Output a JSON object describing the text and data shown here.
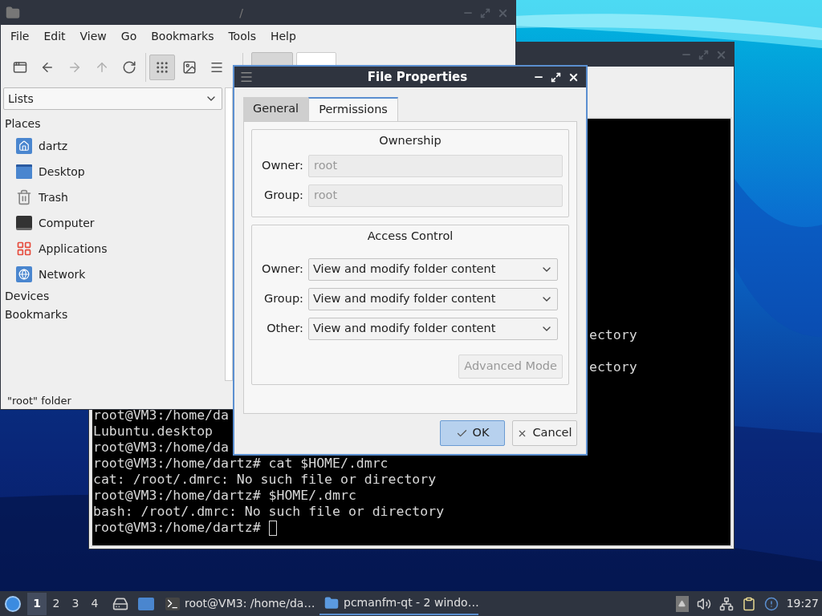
{
  "file_manager": {
    "title": "/",
    "menu": [
      "File",
      "Edit",
      "View",
      "Go",
      "Bookmarks",
      "Tools",
      "Help"
    ],
    "nav": [
      {
        "kind": "new-window",
        "disabled": false
      },
      {
        "kind": "back",
        "disabled": false
      },
      {
        "kind": "forward",
        "disabled": true
      },
      {
        "kind": "up",
        "disabled": true
      },
      {
        "kind": "reload",
        "disabled": false
      }
    ],
    "views": [
      {
        "kind": "icons",
        "selected": true
      },
      {
        "kind": "thumbnails",
        "selected": false
      },
      {
        "kind": "list",
        "selected": false
      }
    ],
    "side_pane": {
      "mode": "Lists",
      "sections": [
        {
          "title": "Places",
          "items": [
            {
              "label": "dartz",
              "kind": "home"
            },
            {
              "label": "Desktop",
              "kind": "desktop"
            },
            {
              "label": "Trash",
              "kind": "trash"
            },
            {
              "label": "Computer",
              "kind": "computer"
            },
            {
              "label": "Applications",
              "kind": "applications"
            },
            {
              "label": "Network",
              "kind": "network"
            }
          ]
        },
        {
          "title": "Devices"
        },
        {
          "title": "Bookmarks"
        }
      ]
    },
    "status": "\"root\" folder"
  },
  "terminal": {
    "tails": [
      "ectory",
      "ectory"
    ],
    "lines": [
      "root@VM3:/home/da",
      "Lubuntu.desktop",
      "root@VM3:/home/da",
      "root@VM3:/home/dartz# cat $HOME/.dmrc",
      "cat: /root/.dmrc: No such file or directory",
      "root@VM3:/home/dartz# $HOME/.dmrc",
      "bash: /root/.dmrc: No such file or directory",
      "root@VM3:/home/dartz# "
    ]
  },
  "dialog": {
    "title": "File Properties",
    "tabs": [
      {
        "label": "General",
        "selected": false
      },
      {
        "label": "Permissions",
        "selected": true
      }
    ],
    "ownership": {
      "title": "Ownership",
      "fields": [
        {
          "label": "Owner:",
          "value": "root",
          "disabled": true
        },
        {
          "label": "Group:",
          "value": "root",
          "disabled": true
        }
      ]
    },
    "access": {
      "title": "Access Control",
      "rows": [
        {
          "label": "Owner:",
          "value": "View and modify folder content"
        },
        {
          "label": "Group:",
          "value": "View and modify folder content"
        },
        {
          "label": "Other:",
          "value": "View and modify folder content"
        }
      ],
      "advanced": {
        "label": "Advanced Mode",
        "disabled": true
      }
    },
    "buttons": [
      {
        "label": "OK",
        "kind": "ok",
        "default": true
      },
      {
        "label": "Cancel",
        "kind": "cancel",
        "default": false
      }
    ]
  },
  "taskbar": {
    "desktops": [
      {
        "label": "1",
        "selected": true
      },
      {
        "label": "2",
        "selected": false
      },
      {
        "label": "3",
        "selected": false
      },
      {
        "label": "4",
        "selected": false
      }
    ],
    "launchers": [
      {
        "kind": "files"
      },
      {
        "kind": "desktop"
      }
    ],
    "tasks": [
      {
        "label": "root@VM3: /home/da…",
        "kind": "terminal",
        "selected": false
      },
      {
        "label": "pcmanfm-qt - 2 windo…",
        "kind": "folder",
        "selected": true
      }
    ],
    "tray": [
      {
        "kind": "expand"
      },
      {
        "kind": "volume"
      },
      {
        "kind": "network"
      },
      {
        "kind": "clipboard"
      },
      {
        "kind": "updates"
      }
    ],
    "clock": "19:27"
  }
}
